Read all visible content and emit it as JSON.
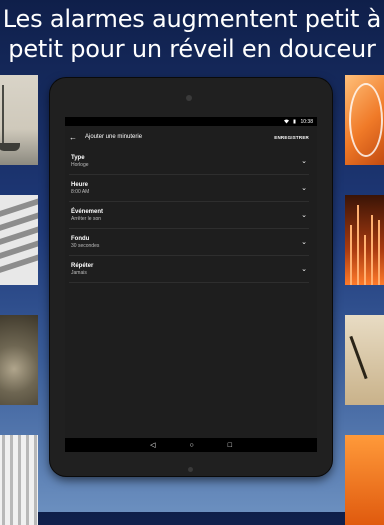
{
  "headline": {
    "line1": "Les alarmes augmentent petit à",
    "line2": "petit pour un réveil en douceur"
  },
  "statusbar": {
    "time": "10:38",
    "icons": [
      "wifi-icon",
      "battery-icon"
    ]
  },
  "appbar": {
    "back_icon": "arrow-back-icon",
    "title": "Ajouter une minuterie",
    "save_label": "ENREGISTRER"
  },
  "settings": [
    {
      "label": "Type",
      "value": "Horloge"
    },
    {
      "label": "Heure",
      "value": "8:00 AM"
    },
    {
      "label": "Événement",
      "value": "Arrêter le son"
    },
    {
      "label": "Fondu",
      "value": "30 secondes"
    },
    {
      "label": "Répéter",
      "value": "Jamais"
    }
  ],
  "navbar": {
    "icons": [
      "back-icon",
      "home-icon",
      "recents-icon"
    ]
  },
  "colors": {
    "screen_bg": "#1e1e1e",
    "tablet_bg": "#202020",
    "bg_top": "#0f1f4a",
    "bg_bottom": "#6b8fbf"
  }
}
